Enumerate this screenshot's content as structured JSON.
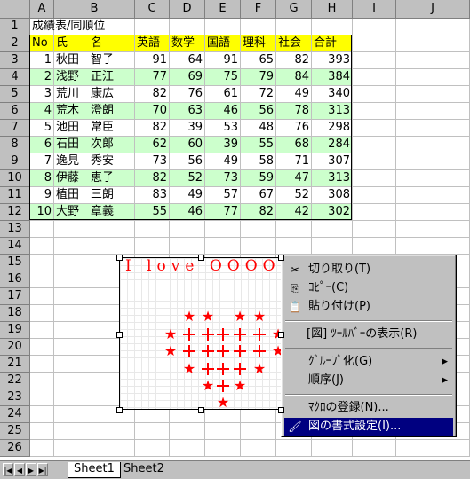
{
  "columns": [
    "A",
    "B",
    "C",
    "D",
    "E",
    "F",
    "G",
    "H",
    "I",
    "J"
  ],
  "rows": [
    "1",
    "2",
    "3",
    "4",
    "5",
    "6",
    "7",
    "8",
    "9",
    "10",
    "11",
    "12",
    "13",
    "14",
    "15",
    "16",
    "17",
    "18",
    "19",
    "20",
    "21",
    "22",
    "23",
    "24",
    "25",
    "26"
  ],
  "title": "成績表/同順位",
  "headers": [
    "No",
    "氏　　名",
    "英語",
    "数学",
    "国語",
    "理科",
    "社会",
    "合計"
  ],
  "students": [
    {
      "no": "1",
      "name": "秋田　智子",
      "v": [
        "91",
        "64",
        "91",
        "65",
        "82",
        "393"
      ]
    },
    {
      "no": "2",
      "name": "浅野　正江",
      "v": [
        "77",
        "69",
        "75",
        "79",
        "84",
        "384"
      ]
    },
    {
      "no": "3",
      "name": "荒川　康広",
      "v": [
        "82",
        "76",
        "61",
        "72",
        "49",
        "340"
      ]
    },
    {
      "no": "4",
      "name": "荒木　澄朗",
      "v": [
        "70",
        "63",
        "46",
        "56",
        "78",
        "313"
      ]
    },
    {
      "no": "5",
      "name": "池田　常臣",
      "v": [
        "82",
        "39",
        "53",
        "48",
        "76",
        "298"
      ]
    },
    {
      "no": "6",
      "name": "石田　次郎",
      "v": [
        "62",
        "60",
        "39",
        "55",
        "68",
        "284"
      ]
    },
    {
      "no": "7",
      "name": "逸見　秀安",
      "v": [
        "73",
        "56",
        "49",
        "58",
        "71",
        "307"
      ]
    },
    {
      "no": "8",
      "name": "伊藤　恵子",
      "v": [
        "82",
        "52",
        "73",
        "59",
        "47",
        "313"
      ]
    },
    {
      "no": "9",
      "name": "植田　三朗",
      "v": [
        "83",
        "49",
        "57",
        "67",
        "52",
        "308"
      ]
    },
    {
      "no": "10",
      "name": "大野　章義",
      "v": [
        "55",
        "46",
        "77",
        "82",
        "42",
        "302"
      ]
    }
  ],
  "picture": {
    "text": "I love OOOO"
  },
  "context_menu": {
    "cut": "切り取り(T)",
    "copy": "ｺﾋﾟｰ(C)",
    "paste": "貼り付け(P)",
    "toolbar": "[図] ﾂｰﾙﾊﾞｰの表示(R)",
    "group": "ｸﾞﾙｰﾌﾟ化(G)",
    "order": "順序(J)",
    "macro": "ﾏｸﾛの登録(N)...",
    "format": "図の書式設定(I)..."
  },
  "tabs": [
    "Sheet1",
    "Sheet2"
  ]
}
